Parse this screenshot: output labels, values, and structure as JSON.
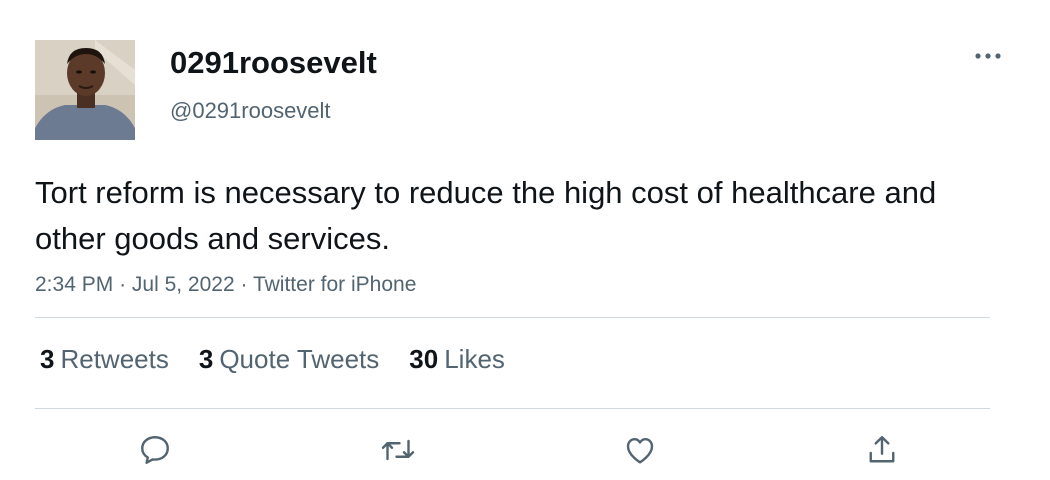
{
  "author": {
    "display_name": "0291roosevelt",
    "handle": "@0291roosevelt",
    "avatar_icon": "profile-photo"
  },
  "tweet": {
    "text": "Tort reform is necessary to reduce the high cost of healthcare and other goods and services.",
    "time": "2:34 PM",
    "date": "Jul 5, 2022",
    "source": "Twitter for iPhone",
    "separator": "·"
  },
  "stats": {
    "retweets": {
      "count": "3",
      "label": "Retweets"
    },
    "quotes": {
      "count": "3",
      "label": "Quote Tweets"
    },
    "likes": {
      "count": "30",
      "label": "Likes"
    }
  },
  "actions": {
    "reply_icon": "speech-bubble-icon",
    "retweet_icon": "retweet-arrows-icon",
    "like_icon": "heart-icon",
    "share_icon": "share-upload-icon",
    "more_icon": "more-dots-icon"
  },
  "colors": {
    "primary_text": "#0f1419",
    "secondary_text": "#536471",
    "divider": "#cfd9de",
    "icon": "#536471"
  }
}
